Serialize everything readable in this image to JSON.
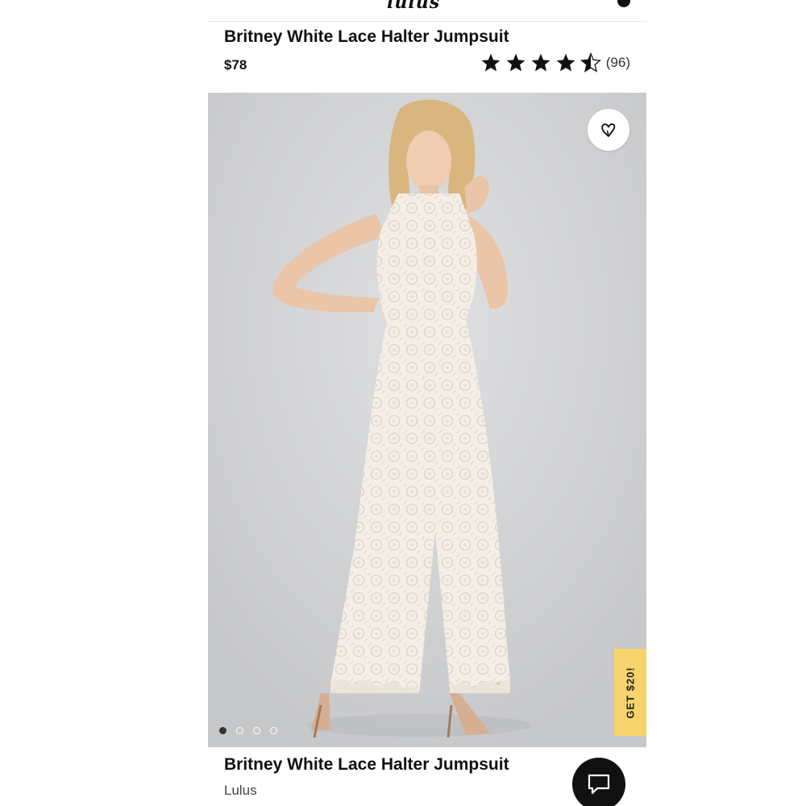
{
  "header": {
    "logo_fragment": "lulus",
    "logo_icon": "account-icon"
  },
  "product": {
    "title": "Britney White Lace Halter Jumpsuit",
    "price": "$78",
    "rating": {
      "value": 4.5,
      "max": 5,
      "count_label": "(96)"
    }
  },
  "gallery": {
    "wishlist_icon": "heart-icon",
    "promo_label": "GET $20!",
    "promo_color": "#f6d36b",
    "slides_total": 4,
    "active_slide": 1
  },
  "card": {
    "title": "Britney White Lace Halter Jumpsuit",
    "brand": "Lulus",
    "chat_icon": "chat-icon"
  }
}
